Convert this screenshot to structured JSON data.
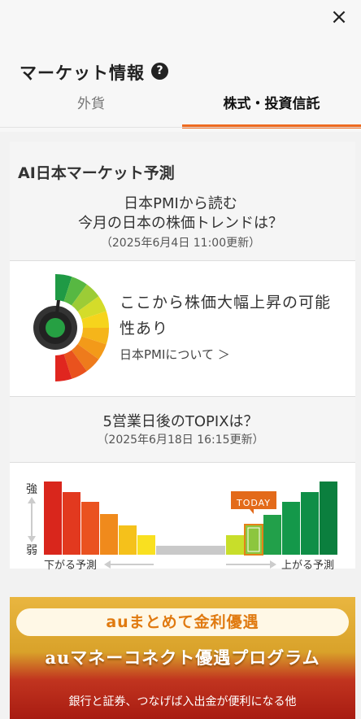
{
  "header": {
    "title": "マーケット情報",
    "help_icon": "?",
    "close_icon": "×"
  },
  "tabs": [
    {
      "label": "外貨",
      "active": false
    },
    {
      "label": "株式・投資信託",
      "active": true
    }
  ],
  "ai": {
    "heading": "AI日本マーケット予測",
    "question_line1": "日本PMIから読む",
    "question_line2": "今月の日本の株価トレンドは？",
    "updated": "（2025年6月4日 11:00更新）",
    "pmi_result_line1": "ここから株価大幅上昇の可能",
    "pmi_result_line2": "性あり",
    "pmi_link": "日本PMIについて ＞"
  },
  "topix": {
    "question": "5営業日後のTOPIXは？",
    "updated": "（2025年6月18日 16:15更新）",
    "strong": "強",
    "weak": "弱",
    "today": "TODAY",
    "down_label": "下がる予測",
    "up_label": "上がる予測"
  },
  "promo": {
    "top": "auまとめて金利優遇",
    "main": "auマネーコネクト優遇プログラム",
    "sub": "銀行と証券、つなげば入出金が便利になる他"
  },
  "colors": {
    "accent": "#ee6a1f"
  }
}
